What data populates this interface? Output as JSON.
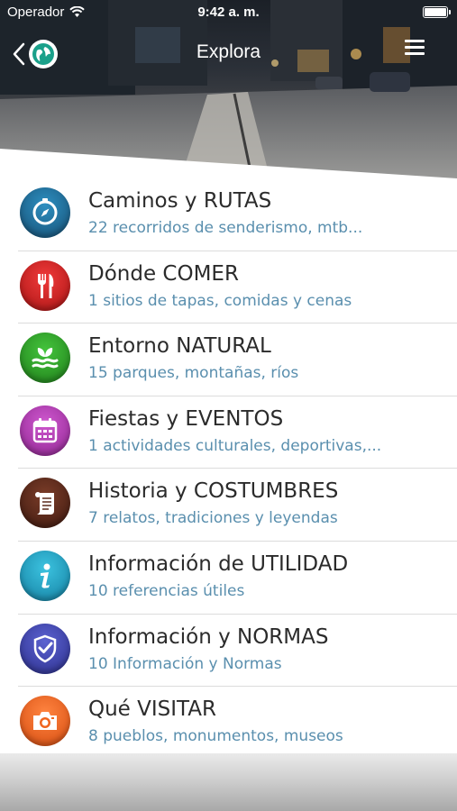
{
  "status_bar": {
    "carrier": "Operador",
    "time": "9:42 a. m."
  },
  "nav": {
    "title": "Explora"
  },
  "colors": {
    "title_text": "#2b2b2b",
    "subtitle_text": "#5a8fae",
    "accent_teal": "#1aa08a"
  },
  "categories": [
    {
      "title": "Caminos y RUTAS",
      "subtitle": "22 recorridos de senderismo, mtb...",
      "icon": "compass-icon",
      "color": "#1f6f9a"
    },
    {
      "title": "Dónde COMER",
      "subtitle": "1 sitios de tapas, comidas y cenas",
      "icon": "fork-knife-icon",
      "color": "#d42424"
    },
    {
      "title": "Entorno NATURAL",
      "subtitle": "15 parques, montañas, ríos",
      "icon": "leaf-icon",
      "color": "#2fa52a"
    },
    {
      "title": "Fiestas y EVENTOS",
      "subtitle": "1 actividades culturales, deportivas,...",
      "icon": "calendar-icon",
      "color": "#b43bb4"
    },
    {
      "title": "Historia y COSTUMBRES",
      "subtitle": "7 relatos, tradiciones y leyendas",
      "icon": "scroll-icon",
      "color": "#5b2a1c"
    },
    {
      "title": "Información de UTILIDAD",
      "subtitle": "10 referencias útiles",
      "icon": "info-icon",
      "color": "#1fa3c4"
    },
    {
      "title": "Información y NORMAS",
      "subtitle": "10 Información y Normas",
      "icon": "shield-check-icon",
      "color": "#3f45b3"
    },
    {
      "title": "Qué VISITAR",
      "subtitle": "8 pueblos, monumentos, museos",
      "icon": "camera-icon",
      "color": "#f0641e"
    }
  ]
}
